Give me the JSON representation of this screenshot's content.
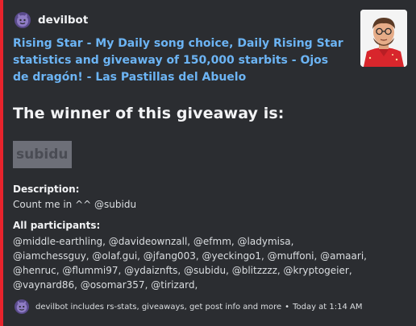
{
  "author": {
    "name": "devilbot",
    "avatar_icon": "devil-face-icon"
  },
  "embed": {
    "accent_color": "#e8232c",
    "title": "Rising Star - My Daily song choice, Daily Rising Star statistics and giveaway of 150,000 starbits  - Ojos de dragón! - Las Pastillas del Abuelo",
    "heading": "The winner of this giveaway is:",
    "winner": "subidu",
    "description_label": "Description:",
    "description_value": "Count me in ^^ @subidu",
    "participants_label": "All participants:",
    "participants_value": "@middle-earthling, @davideownzall, @efmm, @ladymisa, @iamchessguy, @olaf.gui, @jfang003, @yeckingo1, @muffoni, @amaari, @henruc, @flummi97, @ydaiznfts, @subidu, @blitzzzz, @kryptogeier, @vaynard86, @osomar357, @tirizard,"
  },
  "footer": {
    "text": "devilbot includes rs-stats, giveaways, get post info and more",
    "separator": "•",
    "timestamp": "Today at 1:14 AM"
  }
}
